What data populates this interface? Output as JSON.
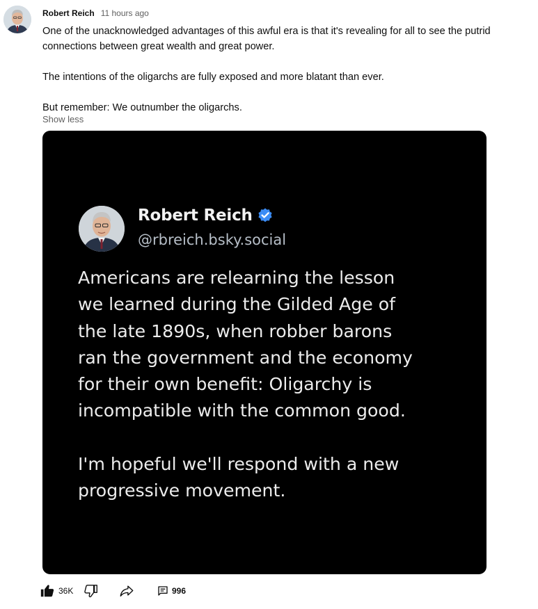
{
  "post": {
    "author": "Robert Reich",
    "time": "11 hours ago",
    "paragraphs": [
      "One of the unacknowledged advantages of this awful era is that it's revealing for all to see the putrid",
      "connections between great wealth and great power.",
      "The intentions of the oligarchs are fully exposed and more blatant than ever.",
      "But remember: We outnumber the oligarchs."
    ],
    "show_less": "Show less"
  },
  "image": {
    "name": "Robert Reich",
    "handle": "@rbreich.bsky.social",
    "lines": [
      "Americans are relearning the lesson",
      "we learned during the Gilded Age of",
      "the late 1890s, when robber barons",
      "ran the government and the economy",
      "for their own benefit: Oligarchy is",
      "incompatible with the common good.",
      "I'm hopeful we'll respond with a new",
      "progressive movement."
    ],
    "verified_color": "#3b8cf5"
  },
  "actions": {
    "likes": "36K",
    "comments": "996"
  },
  "icons": {
    "like": "thumb-up-icon",
    "dislike": "thumb-down-icon",
    "share": "share-icon",
    "comment": "comment-icon",
    "verified": "verified-check-icon"
  }
}
